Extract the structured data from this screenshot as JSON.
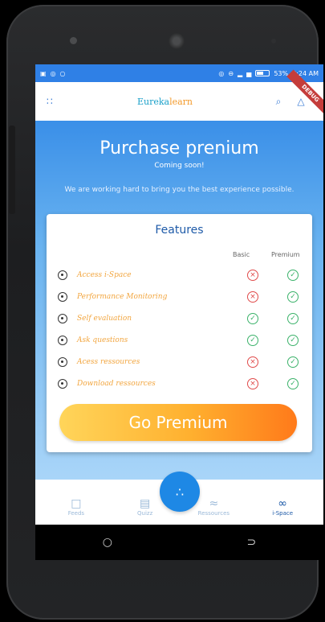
{
  "statusbar": {
    "left_icons": [
      "▣",
      "◎",
      "○"
    ],
    "battery": "53%",
    "time": "3:24 AM",
    "indicators": [
      "◎",
      "⊖",
      "▂",
      "▅"
    ]
  },
  "appbar": {
    "brand_eureka": "Eureka",
    "brand_learn": "learn",
    "menu_icon": "grid-icon",
    "search_icon": "search-icon",
    "bell_icon": "notification-icon",
    "debug_badge": "DEBUG"
  },
  "main": {
    "title": "Purchase prenium",
    "subtitle": "Coming soon!",
    "tagline": "We are working hard to bring you the best experience possible."
  },
  "card": {
    "title": "Features",
    "col_basic": "Basic",
    "col_premium": "Premium",
    "features": [
      {
        "name": "Access i-Space",
        "basic": "no",
        "premium": "yes"
      },
      {
        "name": "Performance Monitoring",
        "basic": "no",
        "premium": "yes"
      },
      {
        "name": "Self evaluation",
        "basic": "yes",
        "premium": "yes"
      },
      {
        "name": "Ask questions",
        "basic": "yes",
        "premium": "yes"
      },
      {
        "name": "Acess ressources",
        "basic": "no",
        "premium": "yes"
      },
      {
        "name": "Download ressources",
        "basic": "no",
        "premium": "yes"
      }
    ],
    "cta": "Go Premium"
  },
  "bottomnav": {
    "items": [
      {
        "label": "Feeds",
        "icon": "chart-icon"
      },
      {
        "label": "Quizz",
        "icon": "quiz-icon"
      },
      {
        "label": "Ressources",
        "icon": "wifi-icon"
      },
      {
        "label": "i-Space",
        "icon": "infinity-icon"
      }
    ],
    "fab_icon": "dots-icon"
  },
  "colors": {
    "primary": "#2f80e6",
    "accent": "#ff9a2f",
    "check": "#3bb26a",
    "cross": "#e04a4a"
  }
}
